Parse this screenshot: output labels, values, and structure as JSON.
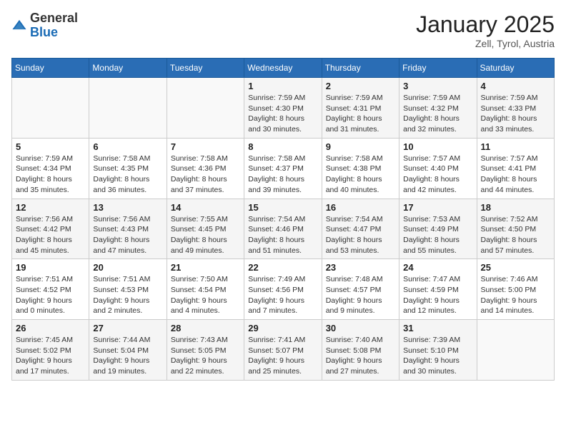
{
  "logo": {
    "general": "General",
    "blue": "Blue"
  },
  "header": {
    "month_year": "January 2025",
    "location": "Zell, Tyrol, Austria"
  },
  "days_of_week": [
    "Sunday",
    "Monday",
    "Tuesday",
    "Wednesday",
    "Thursday",
    "Friday",
    "Saturday"
  ],
  "weeks": [
    [
      {
        "day": "",
        "info": ""
      },
      {
        "day": "",
        "info": ""
      },
      {
        "day": "",
        "info": ""
      },
      {
        "day": "1",
        "info": "Sunrise: 7:59 AM\nSunset: 4:30 PM\nDaylight: 8 hours\nand 30 minutes."
      },
      {
        "day": "2",
        "info": "Sunrise: 7:59 AM\nSunset: 4:31 PM\nDaylight: 8 hours\nand 31 minutes."
      },
      {
        "day": "3",
        "info": "Sunrise: 7:59 AM\nSunset: 4:32 PM\nDaylight: 8 hours\nand 32 minutes."
      },
      {
        "day": "4",
        "info": "Sunrise: 7:59 AM\nSunset: 4:33 PM\nDaylight: 8 hours\nand 33 minutes."
      }
    ],
    [
      {
        "day": "5",
        "info": "Sunrise: 7:59 AM\nSunset: 4:34 PM\nDaylight: 8 hours\nand 35 minutes."
      },
      {
        "day": "6",
        "info": "Sunrise: 7:58 AM\nSunset: 4:35 PM\nDaylight: 8 hours\nand 36 minutes."
      },
      {
        "day": "7",
        "info": "Sunrise: 7:58 AM\nSunset: 4:36 PM\nDaylight: 8 hours\nand 37 minutes."
      },
      {
        "day": "8",
        "info": "Sunrise: 7:58 AM\nSunset: 4:37 PM\nDaylight: 8 hours\nand 39 minutes."
      },
      {
        "day": "9",
        "info": "Sunrise: 7:58 AM\nSunset: 4:38 PM\nDaylight: 8 hours\nand 40 minutes."
      },
      {
        "day": "10",
        "info": "Sunrise: 7:57 AM\nSunset: 4:40 PM\nDaylight: 8 hours\nand 42 minutes."
      },
      {
        "day": "11",
        "info": "Sunrise: 7:57 AM\nSunset: 4:41 PM\nDaylight: 8 hours\nand 44 minutes."
      }
    ],
    [
      {
        "day": "12",
        "info": "Sunrise: 7:56 AM\nSunset: 4:42 PM\nDaylight: 8 hours\nand 45 minutes."
      },
      {
        "day": "13",
        "info": "Sunrise: 7:56 AM\nSunset: 4:43 PM\nDaylight: 8 hours\nand 47 minutes."
      },
      {
        "day": "14",
        "info": "Sunrise: 7:55 AM\nSunset: 4:45 PM\nDaylight: 8 hours\nand 49 minutes."
      },
      {
        "day": "15",
        "info": "Sunrise: 7:54 AM\nSunset: 4:46 PM\nDaylight: 8 hours\nand 51 minutes."
      },
      {
        "day": "16",
        "info": "Sunrise: 7:54 AM\nSunset: 4:47 PM\nDaylight: 8 hours\nand 53 minutes."
      },
      {
        "day": "17",
        "info": "Sunrise: 7:53 AM\nSunset: 4:49 PM\nDaylight: 8 hours\nand 55 minutes."
      },
      {
        "day": "18",
        "info": "Sunrise: 7:52 AM\nSunset: 4:50 PM\nDaylight: 8 hours\nand 57 minutes."
      }
    ],
    [
      {
        "day": "19",
        "info": "Sunrise: 7:51 AM\nSunset: 4:52 PM\nDaylight: 9 hours\nand 0 minutes."
      },
      {
        "day": "20",
        "info": "Sunrise: 7:51 AM\nSunset: 4:53 PM\nDaylight: 9 hours\nand 2 minutes."
      },
      {
        "day": "21",
        "info": "Sunrise: 7:50 AM\nSunset: 4:54 PM\nDaylight: 9 hours\nand 4 minutes."
      },
      {
        "day": "22",
        "info": "Sunrise: 7:49 AM\nSunset: 4:56 PM\nDaylight: 9 hours\nand 7 minutes."
      },
      {
        "day": "23",
        "info": "Sunrise: 7:48 AM\nSunset: 4:57 PM\nDaylight: 9 hours\nand 9 minutes."
      },
      {
        "day": "24",
        "info": "Sunrise: 7:47 AM\nSunset: 4:59 PM\nDaylight: 9 hours\nand 12 minutes."
      },
      {
        "day": "25",
        "info": "Sunrise: 7:46 AM\nSunset: 5:00 PM\nDaylight: 9 hours\nand 14 minutes."
      }
    ],
    [
      {
        "day": "26",
        "info": "Sunrise: 7:45 AM\nSunset: 5:02 PM\nDaylight: 9 hours\nand 17 minutes."
      },
      {
        "day": "27",
        "info": "Sunrise: 7:44 AM\nSunset: 5:04 PM\nDaylight: 9 hours\nand 19 minutes."
      },
      {
        "day": "28",
        "info": "Sunrise: 7:43 AM\nSunset: 5:05 PM\nDaylight: 9 hours\nand 22 minutes."
      },
      {
        "day": "29",
        "info": "Sunrise: 7:41 AM\nSunset: 5:07 PM\nDaylight: 9 hours\nand 25 minutes."
      },
      {
        "day": "30",
        "info": "Sunrise: 7:40 AM\nSunset: 5:08 PM\nDaylight: 9 hours\nand 27 minutes."
      },
      {
        "day": "31",
        "info": "Sunrise: 7:39 AM\nSunset: 5:10 PM\nDaylight: 9 hours\nand 30 minutes."
      },
      {
        "day": "",
        "info": ""
      }
    ]
  ]
}
